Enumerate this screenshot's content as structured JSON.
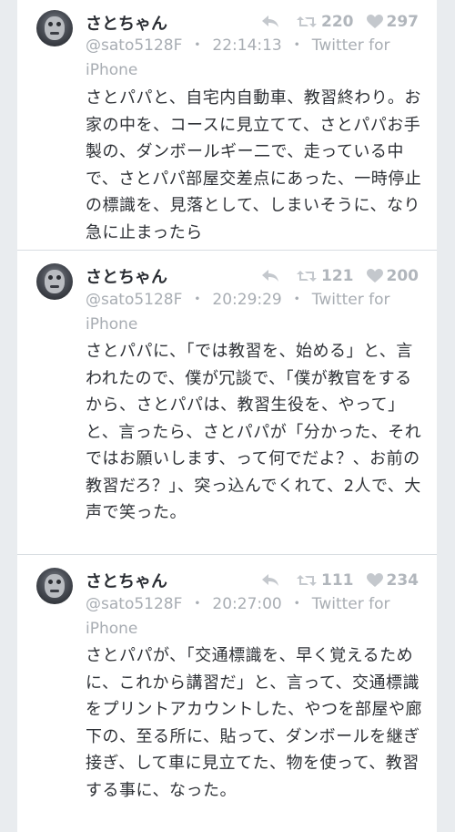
{
  "tweets": [
    {
      "name": "さとちゃん",
      "handle": "@sato5128F",
      "time": "22:14:13",
      "separator": "・",
      "source": "Twitter for iPhone",
      "retweets": "220",
      "favorites": "297",
      "text": "さとパパと、自宅内自動車、教習終わり。お家の中を、コースに見立てて、さとパパお手製の、ダンボールギー二で、走っている中で、さとパパ部屋交差点にあった、一時停止の標識を、見落として、しまいそうに、なり急に止まったら"
    },
    {
      "name": "さとちゃん",
      "handle": "@sato5128F",
      "time": "20:29:29",
      "separator": "・",
      "source": "Twitter for iPhone",
      "retweets": "121",
      "favorites": "200",
      "text": "さとパパに、「では教習を、始める」と、言われたので、僕が冗談で、「僕が教官をするから、さとパパは、教習生役を、やって」と、言ったら、さとパパが「分かった、それではお願いします、って何でだよ？、お前の教習だろ？」、突っ込んでくれて、2人で、大声で笑った。"
    },
    {
      "name": "さとちゃん",
      "handle": "@sato5128F",
      "time": "20:27:00",
      "separator": "・",
      "source": "Twitter for iPhone",
      "retweets": "111",
      "favorites": "234",
      "text": "さとパパが、「交通標識を、早く覚えるために、これから講習だ」と、言って、交通標識をプリントアカウントした、やつを部屋や廊下の、至る所に、貼って、ダンボールを継ぎ接ぎ、して車に見立てた、物を使って、教習する事に、なった。"
    }
  ],
  "icons": {
    "avatar": "avatar-image",
    "reply": "reply-icon",
    "retweet": "retweet-icon",
    "favorite": "heart-icon"
  }
}
